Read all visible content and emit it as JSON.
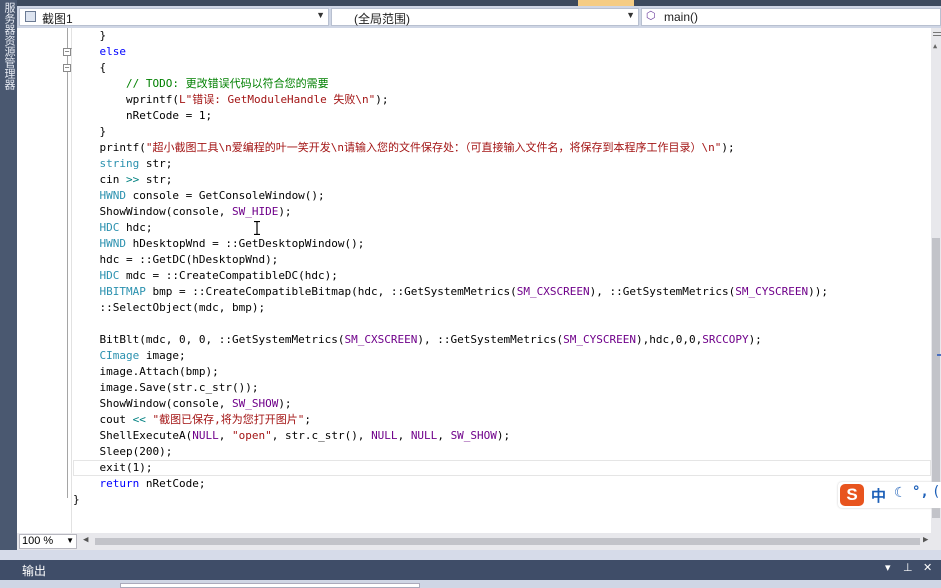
{
  "side_panel": {
    "label": "服务器资源管理器"
  },
  "navbar": {
    "project": "截图1",
    "scope": "(全局范围)",
    "member": "main()"
  },
  "code_lines": [
    {
      "indent": "    ",
      "parts": [
        {
          "t": "}",
          "c": ""
        }
      ]
    },
    {
      "indent": "    ",
      "parts": [
        {
          "t": "else",
          "c": "kw"
        }
      ]
    },
    {
      "indent": "    ",
      "parts": [
        {
          "t": "{",
          "c": ""
        }
      ]
    },
    {
      "indent": "        ",
      "parts": [
        {
          "t": "// TODO: 更改错误代码以符合您的需要",
          "c": "cm"
        }
      ]
    },
    {
      "indent": "        ",
      "parts": [
        {
          "t": "wprintf(",
          "c": ""
        },
        {
          "t": "L\"错误: GetModuleHandle 失败\\n\"",
          "c": "str"
        },
        {
          "t": ");",
          "c": ""
        }
      ]
    },
    {
      "indent": "        ",
      "parts": [
        {
          "t": "nRetCode = 1;",
          "c": ""
        }
      ]
    },
    {
      "indent": "    ",
      "parts": [
        {
          "t": "}",
          "c": ""
        }
      ]
    },
    {
      "indent": "    ",
      "parts": [
        {
          "t": "printf(",
          "c": ""
        },
        {
          "t": "\"超小截图工具\\n爱编程的叶一笑开发\\n请输入您的文件保存处：（可直接输入文件名，将保存到本程序工作目录）\\n\"",
          "c": "str"
        },
        {
          "t": ");",
          "c": ""
        }
      ]
    },
    {
      "indent": "    ",
      "parts": [
        {
          "t": "string",
          "c": "ty"
        },
        {
          "t": " str;",
          "c": ""
        }
      ]
    },
    {
      "indent": "    ",
      "parts": [
        {
          "t": "cin ",
          "c": ""
        },
        {
          "t": ">>",
          "c": "op"
        },
        {
          "t": " str;",
          "c": ""
        }
      ]
    },
    {
      "indent": "    ",
      "parts": [
        {
          "t": "HWND",
          "c": "ty"
        },
        {
          "t": " console = GetConsoleWindow();",
          "c": ""
        }
      ]
    },
    {
      "indent": "    ",
      "parts": [
        {
          "t": "ShowWindow(console, ",
          "c": ""
        },
        {
          "t": "SW_HIDE",
          "c": "mac"
        },
        {
          "t": ");",
          "c": ""
        }
      ]
    },
    {
      "indent": "    ",
      "parts": [
        {
          "t": "HDC",
          "c": "ty"
        },
        {
          "t": " hdc;",
          "c": ""
        }
      ]
    },
    {
      "indent": "    ",
      "parts": [
        {
          "t": "HWND",
          "c": "ty"
        },
        {
          "t": " hDesktopWnd = ::GetDesktopWindow();",
          "c": ""
        }
      ]
    },
    {
      "indent": "    ",
      "parts": [
        {
          "t": "hdc = ::GetDC(hDesktopWnd);",
          "c": ""
        }
      ]
    },
    {
      "indent": "    ",
      "parts": [
        {
          "t": "HDC",
          "c": "ty"
        },
        {
          "t": " mdc = ::CreateCompatibleDC(hdc);",
          "c": ""
        }
      ]
    },
    {
      "indent": "    ",
      "parts": [
        {
          "t": "HBITMAP",
          "c": "ty"
        },
        {
          "t": " bmp = ::CreateCompatibleBitmap(hdc, ::GetSystemMetrics(",
          "c": ""
        },
        {
          "t": "SM_CXSCREEN",
          "c": "mac"
        },
        {
          "t": "), ::GetSystemMetrics(",
          "c": ""
        },
        {
          "t": "SM_CYSCREEN",
          "c": "mac"
        },
        {
          "t": "));",
          "c": ""
        }
      ]
    },
    {
      "indent": "    ",
      "parts": [
        {
          "t": "::SelectObject(mdc, bmp);",
          "c": ""
        }
      ]
    },
    {
      "indent": "",
      "parts": []
    },
    {
      "indent": "    ",
      "parts": [
        {
          "t": "BitBlt(mdc, 0, 0, ::GetSystemMetrics(",
          "c": ""
        },
        {
          "t": "SM_CXSCREEN",
          "c": "mac"
        },
        {
          "t": "), ::GetSystemMetrics(",
          "c": ""
        },
        {
          "t": "SM_CYSCREEN",
          "c": "mac"
        },
        {
          "t": "),hdc,0,0,",
          "c": ""
        },
        {
          "t": "SRCCOPY",
          "c": "mac"
        },
        {
          "t": ");",
          "c": ""
        }
      ]
    },
    {
      "indent": "    ",
      "parts": [
        {
          "t": "CImage",
          "c": "ty"
        },
        {
          "t": " image;",
          "c": ""
        }
      ]
    },
    {
      "indent": "    ",
      "parts": [
        {
          "t": "image.Attach(bmp);",
          "c": ""
        }
      ]
    },
    {
      "indent": "    ",
      "parts": [
        {
          "t": "image.Save(str.c_str());",
          "c": ""
        }
      ]
    },
    {
      "indent": "    ",
      "parts": [
        {
          "t": "ShowWindow(console, ",
          "c": ""
        },
        {
          "t": "SW_SHOW",
          "c": "mac"
        },
        {
          "t": ");",
          "c": ""
        }
      ]
    },
    {
      "indent": "    ",
      "parts": [
        {
          "t": "cout ",
          "c": ""
        },
        {
          "t": "<<",
          "c": "op"
        },
        {
          "t": " ",
          "c": ""
        },
        {
          "t": "\"截图已保存,将为您打开图片\"",
          "c": "str"
        },
        {
          "t": ";",
          "c": ""
        }
      ]
    },
    {
      "indent": "    ",
      "parts": [
        {
          "t": "ShellExecuteA(",
          "c": ""
        },
        {
          "t": "NULL",
          "c": "mac"
        },
        {
          "t": ", ",
          "c": ""
        },
        {
          "t": "\"open\"",
          "c": "str"
        },
        {
          "t": ", str.c_str(), ",
          "c": ""
        },
        {
          "t": "NULL",
          "c": "mac"
        },
        {
          "t": ", ",
          "c": ""
        },
        {
          "t": "NULL",
          "c": "mac"
        },
        {
          "t": ", ",
          "c": ""
        },
        {
          "t": "SW_SHOW",
          "c": "mac"
        },
        {
          "t": ");",
          "c": ""
        }
      ]
    },
    {
      "indent": "    ",
      "parts": [
        {
          "t": "Sleep(200);",
          "c": ""
        }
      ]
    },
    {
      "indent": "    ",
      "parts": [
        {
          "t": "exit(1);",
          "c": ""
        }
      ]
    },
    {
      "indent": "    ",
      "parts": [
        {
          "t": "return",
          "c": "kw"
        },
        {
          "t": " nRetCode;",
          "c": ""
        }
      ]
    },
    {
      "indent": "",
      "parts": [
        {
          "t": "}",
          "c": ""
        }
      ]
    }
  ],
  "zoom": {
    "value": "100 %"
  },
  "output_panel": {
    "title": "输出"
  },
  "ime": {
    "logo": "S",
    "mode": "中",
    "punct": "°,",
    "paren": "("
  }
}
